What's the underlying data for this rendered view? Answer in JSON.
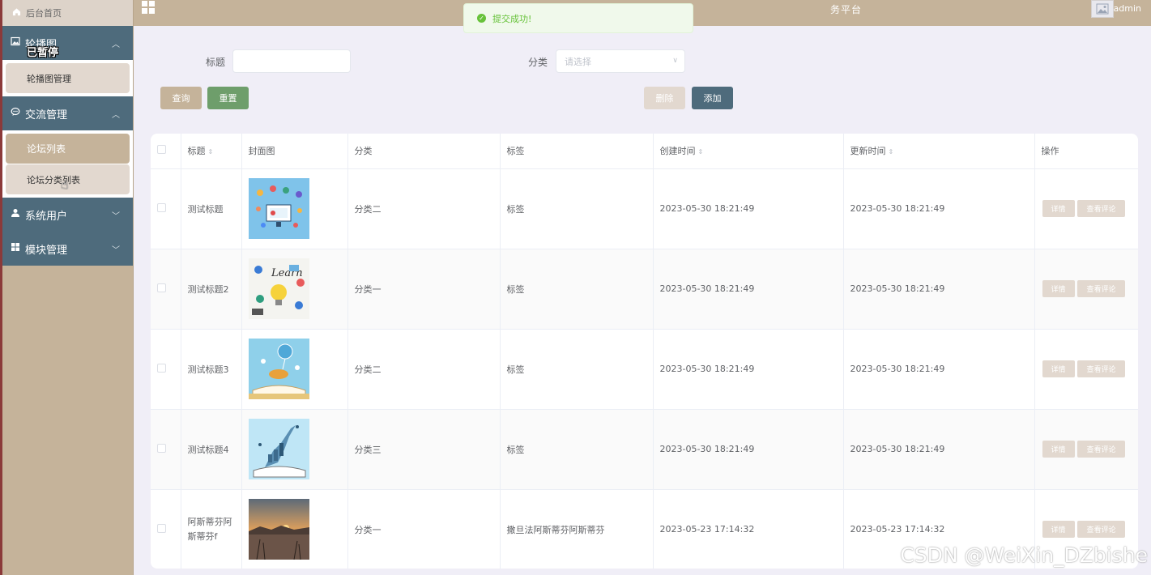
{
  "sidebar": {
    "home": "后台首页",
    "groups": [
      {
        "label": "轮播图",
        "items": [
          "轮播图管理"
        ]
      },
      {
        "label": "交流管理",
        "items": [
          "论坛列表",
          "论坛分类列表"
        ]
      },
      {
        "label": "系统用户",
        "items": []
      },
      {
        "label": "模块管理",
        "items": []
      }
    ],
    "paused_overlay": "已暂停"
  },
  "header": {
    "title_fragment": "务平台",
    "user": "admin"
  },
  "toast": {
    "message": "提交成功!"
  },
  "filters": {
    "title_label": "标题",
    "title_value": "",
    "category_label": "分类",
    "category_placeholder": "请选择"
  },
  "buttons": {
    "query": "查询",
    "reset": "重置",
    "delete": "删除",
    "add": "添加"
  },
  "colors": {
    "sidebar_bg": "#c5b39a",
    "group_bg": "#4e6b7c",
    "reset_btn": "#6e9e6b",
    "add_btn": "#4e6b7c",
    "toast_green": "#67c23a"
  },
  "table": {
    "headers": [
      "标题",
      "封面图",
      "分类",
      "标签",
      "创建时间",
      "更新时间",
      "操作"
    ],
    "rows": [
      {
        "title": "测试标题",
        "category": "分类二",
        "tag": "标签",
        "created": "2023-05-30 18:21:49",
        "updated": "2023-05-30 18:21:49",
        "image": "icons-illustration"
      },
      {
        "title": "测试标题2",
        "category": "分类一",
        "tag": "标签",
        "created": "2023-05-30 18:21:49",
        "updated": "2023-05-30 18:21:49",
        "image": "learn-lightbulb",
        "image_text": "Learn"
      },
      {
        "title": "测试标题3",
        "category": "分类二",
        "tag": "标签",
        "created": "2023-05-30 18:21:49",
        "updated": "2023-05-30 18:21:49",
        "image": "book-balloon"
      },
      {
        "title": "测试标题4",
        "category": "分类三",
        "tag": "标签",
        "created": "2023-05-30 18:21:49",
        "updated": "2023-05-30 18:21:49",
        "image": "book-city"
      },
      {
        "title": "阿斯蒂芬阿斯蒂芬f",
        "category": "分类一",
        "tag": "撒旦法阿斯蒂芬阿斯蒂芬",
        "created": "2023-05-23 17:14:32",
        "updated": "2023-05-23 17:14:32",
        "image": "sunset-lake"
      }
    ],
    "actions": {
      "detail": "详情",
      "comments": "查看评论"
    }
  },
  "watermark": "CSDN @WeiXin_DZbishe"
}
